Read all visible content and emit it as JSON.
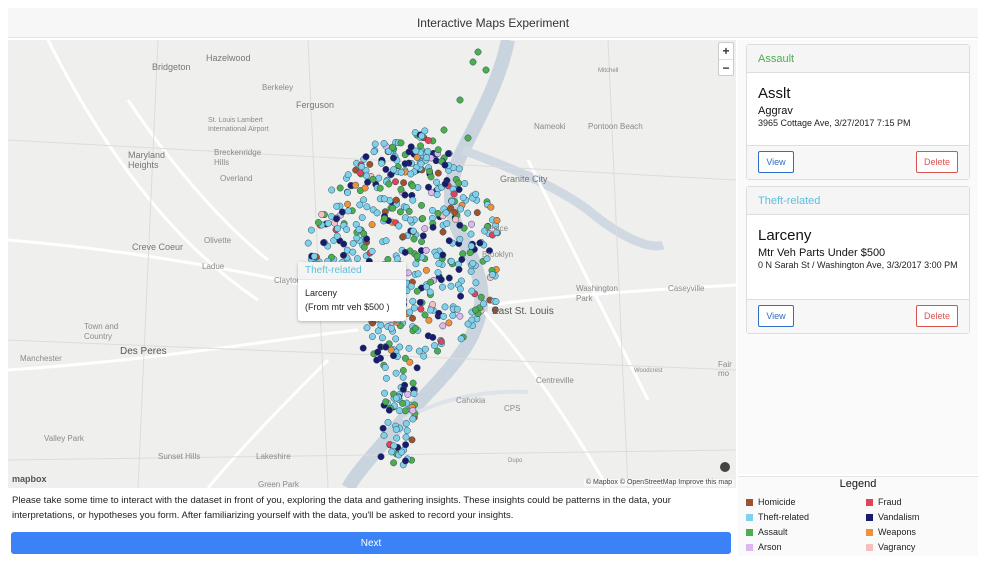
{
  "window": {
    "title": "Interactive Maps Experiment"
  },
  "map": {
    "zoom_in": "+",
    "zoom_out": "−",
    "attribution": "© Mapbox © OpenStreetMap  Improve this map",
    "logo": "mapbox",
    "places": {
      "bridgeton": "Bridgeton",
      "hazelwood": "Hazelwood",
      "berkeley": "Berkeley",
      "ferguson": "Ferguson",
      "airport": "St. Louis Lambert\nInternational Airport",
      "maryland_heights": "Maryland\nHeights",
      "breckenridge_hills": "Breckenridge\nHills",
      "overland": "Overland",
      "creve_coeur": "Creve Coeur",
      "olivette": "Olivette",
      "ladue": "Ladue",
      "clayton": "Clayton",
      "town_and_country": "Town and\nCountry",
      "des_peres": "Des Peres",
      "manchester": "Manchester",
      "valley_park": "Valley Park",
      "sunset_hills": "Sunset Hills",
      "lakeshire": "Lakeshire",
      "green_park": "Green Park",
      "nameoki": "Nameoki",
      "pontoon_beach": "Pontoon Beach",
      "granite_city": "Granite City",
      "venice": "Venice",
      "brooklyn": "Brooklyn",
      "washington_park": "Washington\nPark",
      "caseyville": "Caseyville",
      "east_st_louis": "East St. Louis",
      "centreville": "Centreville",
      "cahokia": "Cahokia",
      "cps": "CPS",
      "woodcrest": "Woodcrest",
      "mitchell": "Mitchell",
      "fairmont": "Fair\nmo",
      "dupo": "Dupo"
    },
    "popup": {
      "category": "Theft-related",
      "line1": "Larceny",
      "line2": "(From mtr veh $500 )"
    }
  },
  "cards": [
    {
      "category": "Assault",
      "category_color": "#4cae4c",
      "title": "Asslt",
      "subtitle": "Aggrav",
      "detail": "3965 Cottage Ave, 3/27/2017 7:15 PM",
      "view_label": "View",
      "delete_label": "Delete"
    },
    {
      "category": "Theft-related",
      "category_color": "#5bc0de",
      "title": "Larceny",
      "subtitle": "Mtr Veh Parts Under $500",
      "detail": "0 N Sarah St / Washington Ave, 3/3/2017 3:00 PM",
      "view_label": "View",
      "delete_label": "Delete"
    }
  ],
  "legend": {
    "title": "Legend",
    "items": [
      {
        "label": "Homicide",
        "color": "#a0522d"
      },
      {
        "label": "Fraud",
        "color": "#e0435a"
      },
      {
        "label": "Theft-related",
        "color": "#7fd0ea"
      },
      {
        "label": "Vandalism",
        "color": "#1a1a6e"
      },
      {
        "label": "Assault",
        "color": "#4cae4c"
      },
      {
        "label": "Weapons",
        "color": "#f0903a"
      },
      {
        "label": "Arson",
        "color": "#dcb8ef"
      },
      {
        "label": "Vagrancy",
        "color": "#f6c0c0"
      }
    ]
  },
  "instructions": "Please take some time to interact with the dataset in front of you, exploring the data and gathering insights. These insights could be patterns in the data, your interpretations, or hypotheses you form. After familiarizing yourself with the data, you'll be asked to record your insights.",
  "next_label": "Next"
}
